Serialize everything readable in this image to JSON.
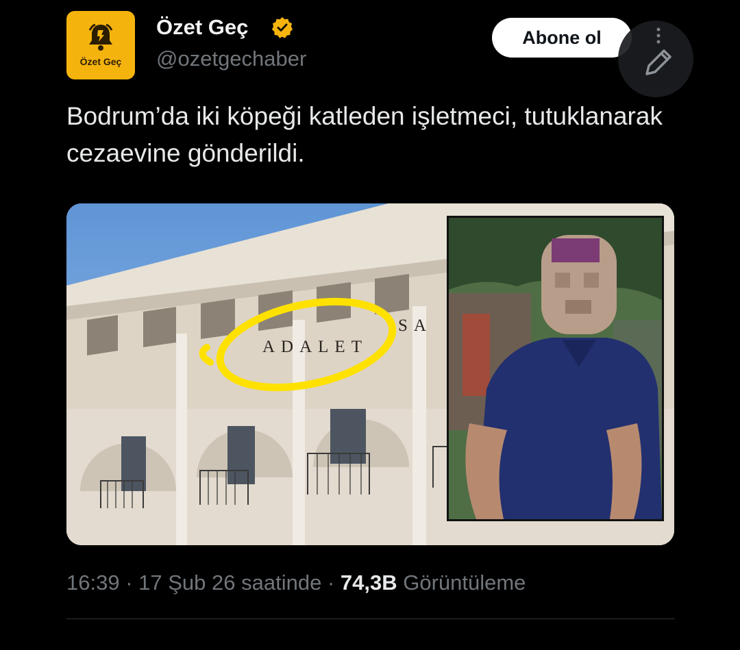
{
  "author": {
    "display_name": "Özet Geç",
    "handle": "@ozetgechaber",
    "avatar_text": "Özet Geç",
    "verified_badge_color": "#f5b30e",
    "avatar_color": "#f5b30e"
  },
  "actions": {
    "follow_label": "Abone ol",
    "compose_icon": "pen-icon",
    "more_icon": "dots-vertical-icon"
  },
  "post": {
    "text": "Bodrum’da iki köpeği katleden işletmeci, tutuklanarak cezaevine gönderildi."
  },
  "media": {
    "sign_text": "ADALET",
    "sign_text_2": "SA"
  },
  "meta": {
    "time": "16:39",
    "separator_1": " · ",
    "date": "17 Şub 26 saatinde",
    "separator_2": " · ",
    "views_count": "74,3B",
    "views_label": " Görüntüleme"
  }
}
